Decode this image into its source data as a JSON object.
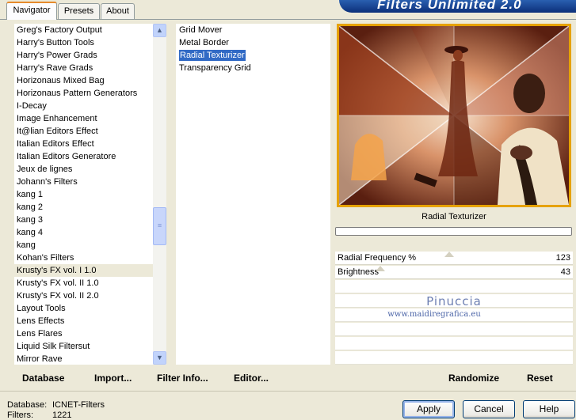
{
  "tabs": [
    {
      "label": "Navigator",
      "active": true
    },
    {
      "label": "Presets",
      "active": false
    },
    {
      "label": "About",
      "active": false
    }
  ],
  "banner_title": "Filters Unlimited 2.0",
  "categories": [
    "Greg's Factory Output",
    "Harry's Button Tools",
    "Harry's Power Grads",
    "Harry's Rave Grads",
    "Horizonaus Mixed Bag",
    "Horizonaus Pattern Generators",
    "I-Decay",
    "Image Enhancement",
    "It@lian Editors Effect",
    "Italian Editors Effect",
    "Italian Editors Generatore",
    "Jeux de lignes",
    "Johann's Filters",
    "kang 1",
    "kang 2",
    "kang 3",
    "kang 4",
    "kang",
    "Kohan's Filters",
    "Krusty's FX vol. I 1.0",
    "Krusty's FX vol. II 1.0",
    "Krusty's FX vol. II 2.0",
    "Layout Tools",
    "Lens Effects",
    "Lens Flares",
    "Liquid Silk Filtersut",
    "Mirror Rave"
  ],
  "highlighted_category": "Krusty's FX vol. I 1.0",
  "filters": [
    "Grid Mover",
    "Metal Border",
    "Radial Texturizer",
    "Transparency Grid"
  ],
  "selected_filter": "Radial Texturizer",
  "preview": {
    "filter_name": "Radial Texturizer",
    "watermark_name": "Pinuccia",
    "watermark_url": "www.maidiregrafica.eu"
  },
  "params": [
    {
      "label": "Radial Frequency %",
      "value": "123",
      "slider_fraction": 0.48
    },
    {
      "label": "Brightness",
      "value": "43",
      "slider_fraction": 0.17
    }
  ],
  "left_buttons": {
    "database": "Database",
    "import": "Import...",
    "filter_info": "Filter Info...",
    "editor": "Editor..."
  },
  "right_buttons": {
    "randomize": "Randomize",
    "reset": "Reset"
  },
  "status": {
    "database_label": "Database:",
    "database_value": "ICNET-Filters",
    "filters_label": "Filters:",
    "filters_value": "1221"
  },
  "dialog_buttons": {
    "apply": "Apply",
    "cancel": "Cancel",
    "help": "Help"
  }
}
